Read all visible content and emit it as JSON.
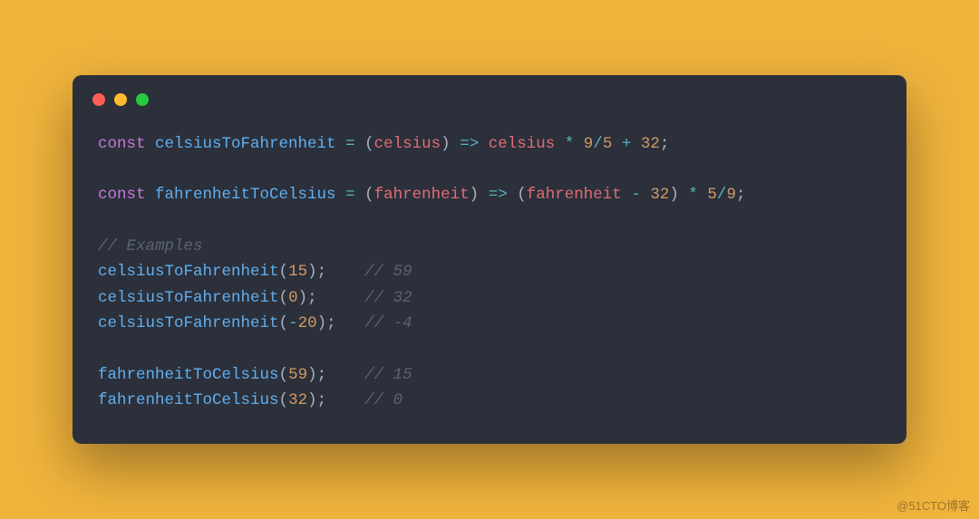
{
  "watermark": "@51CTO博客",
  "code": {
    "line1": {
      "t1": "const",
      "t2": " ",
      "t3": "celsiusToFahrenheit",
      "t4": " ",
      "t5": "=",
      "t6": " ",
      "t7": "(",
      "t8": "celsius",
      "t9": ")",
      "t10": " ",
      "t11": "=>",
      "t12": " ",
      "t13": "celsius",
      "t14": " ",
      "t15": "*",
      "t16": " ",
      "t17": "9",
      "t18": "/",
      "t19": "5",
      "t20": " ",
      "t21": "+",
      "t22": " ",
      "t23": "32",
      "t24": ";"
    },
    "line3": {
      "t1": "const",
      "t2": " ",
      "t3": "fahrenheitToCelsius",
      "t4": " ",
      "t5": "=",
      "t6": " ",
      "t7": "(",
      "t8": "fahrenheit",
      "t9": ")",
      "t10": " ",
      "t11": "=>",
      "t12": " ",
      "t13": "(",
      "t14": "fahrenheit",
      "t15": " ",
      "t16": "-",
      "t17": " ",
      "t18": "32",
      "t19": ")",
      "t20": " ",
      "t21": "*",
      "t22": " ",
      "t23": "5",
      "t24": "/",
      "t25": "9",
      "t26": ";"
    },
    "line5": {
      "t1": "// Examples"
    },
    "line6": {
      "t1": "celsiusToFahrenheit",
      "t2": "(",
      "t3": "15",
      "t4": ");",
      "t5": "    ",
      "t6": "// 59"
    },
    "line7": {
      "t1": "celsiusToFahrenheit",
      "t2": "(",
      "t3": "0",
      "t4": ");",
      "t5": "     ",
      "t6": "// 32"
    },
    "line8": {
      "t1": "celsiusToFahrenheit",
      "t2": "(",
      "t3": "-",
      "t4": "20",
      "t5": ");",
      "t6": "   ",
      "t7": "// -4"
    },
    "line10": {
      "t1": "fahrenheitToCelsius",
      "t2": "(",
      "t3": "59",
      "t4": ");",
      "t5": "    ",
      "t6": "// 15"
    },
    "line11": {
      "t1": "fahrenheitToCelsius",
      "t2": "(",
      "t3": "32",
      "t4": ");",
      "t5": "    ",
      "t6": "// 0"
    }
  }
}
